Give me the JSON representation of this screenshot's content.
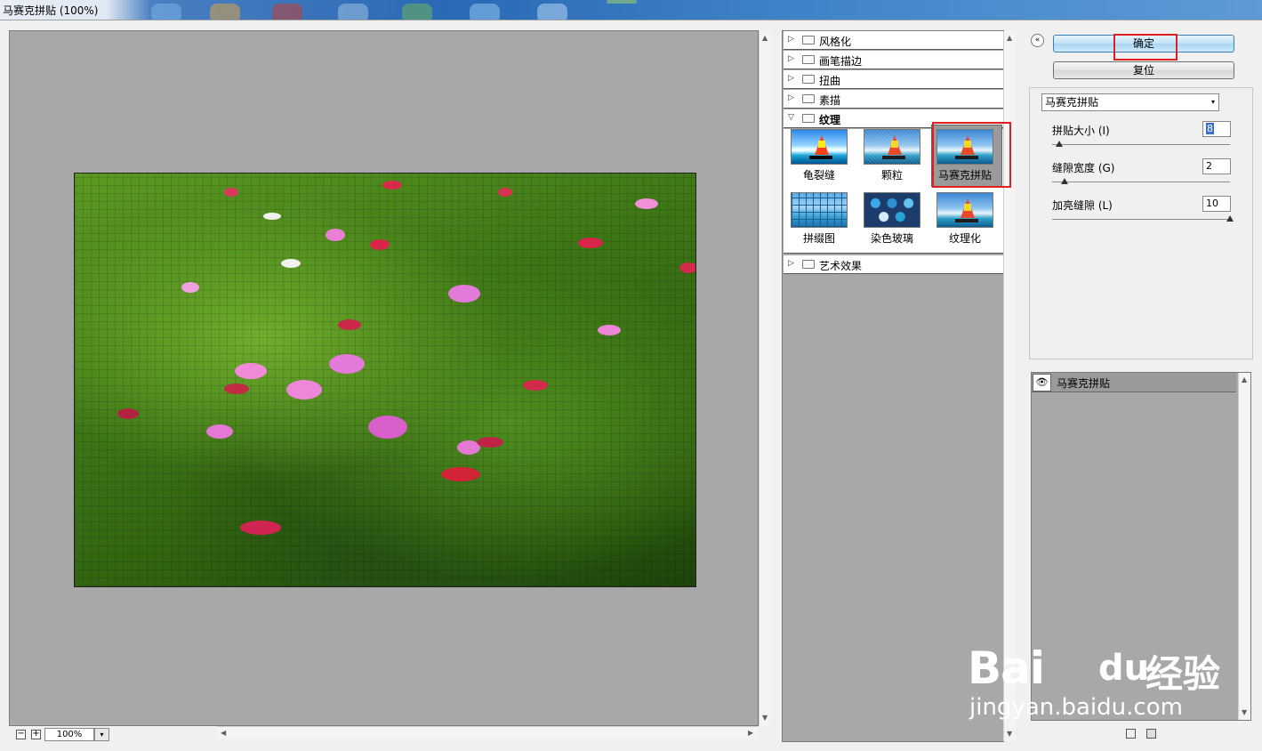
{
  "window": {
    "title": "马赛克拼贴 (100%)"
  },
  "preview": {
    "zoom_value": "100%",
    "zoom_out_glyph": "−",
    "zoom_in_glyph": "+",
    "dropdown_glyph": "▾",
    "scroll_up_glyph": "▲",
    "scroll_down_glyph": "▼",
    "scroll_left_glyph": "◀",
    "scroll_right_glyph": "▶"
  },
  "gallery": {
    "categories": [
      {
        "label": "风格化",
        "expanded": false
      },
      {
        "label": "画笔描边",
        "expanded": false
      },
      {
        "label": "扭曲",
        "expanded": false
      },
      {
        "label": "素描",
        "expanded": false
      },
      {
        "label": "纹理",
        "expanded": true
      },
      {
        "label": "艺术效果",
        "expanded": false
      }
    ],
    "collapsed_glyph": "▷",
    "expanded_glyph": "▽",
    "texture_filters": [
      {
        "label": "龟裂缝",
        "icon": "craquelure-thumbnail"
      },
      {
        "label": "颗粒",
        "icon": "grain-thumbnail"
      },
      {
        "label": "马赛克拼贴",
        "icon": "mosaic-tiles-thumbnail",
        "selected": true
      },
      {
        "label": "拼缀图",
        "icon": "patchwork-thumbnail"
      },
      {
        "label": "染色玻璃",
        "icon": "stained-glass-thumbnail"
      },
      {
        "label": "纹理化",
        "icon": "texturizer-thumbnail"
      }
    ]
  },
  "controls": {
    "collapse_glyph": "«",
    "ok_label": "确定",
    "reset_label": "复位",
    "filter_select": "马赛克拼贴",
    "select_caret": "▾",
    "params": [
      {
        "label": "拼贴大小 (I)",
        "value": "8",
        "slider_fraction": 0.04
      },
      {
        "label": "缝隙宽度 (G)",
        "value": "2",
        "slider_fraction": 0.07
      },
      {
        "label": "加亮缝隙 (L)",
        "value": "10",
        "slider_fraction": 1.0
      }
    ]
  },
  "layers": {
    "items": [
      {
        "name": "马赛克拼贴",
        "visible_glyph": "👁"
      }
    ]
  },
  "watermark": {
    "brand_a": "Bai",
    "brand_b": "du",
    "brand_cn": "经验",
    "url": "jingyan.baidu.com"
  },
  "colors": {
    "highlight_box": "#e02020",
    "preview_bg": "#a8a8a8",
    "primary_button": "#bfe2f7"
  }
}
